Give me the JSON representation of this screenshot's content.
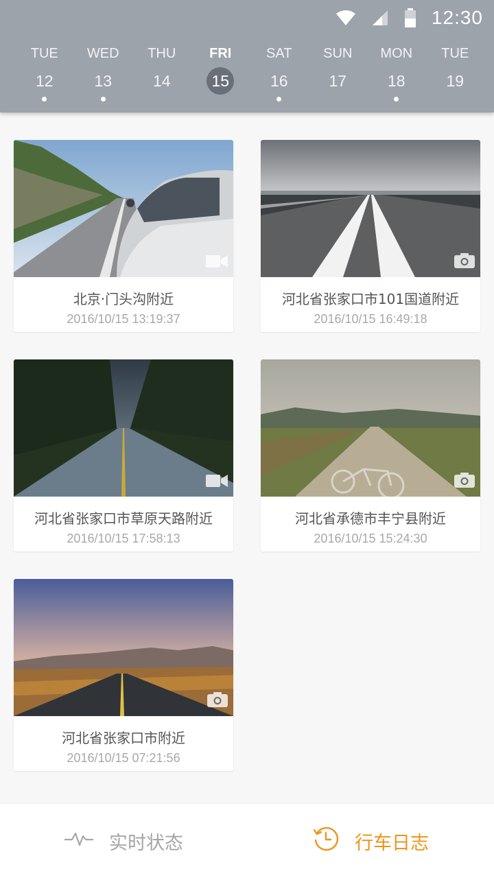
{
  "status_bar": {
    "time": "12:30",
    "icons": [
      "wifi-icon",
      "cell-signal-icon",
      "battery-icon"
    ]
  },
  "calendar": {
    "days": [
      {
        "dow": "TUE",
        "date": "12",
        "has_entries": true,
        "selected": false
      },
      {
        "dow": "WED",
        "date": "13",
        "has_entries": true,
        "selected": false
      },
      {
        "dow": "THU",
        "date": "14",
        "has_entries": false,
        "selected": false
      },
      {
        "dow": "FRI",
        "date": "15",
        "has_entries": false,
        "selected": true
      },
      {
        "dow": "SAT",
        "date": "16",
        "has_entries": true,
        "selected": false
      },
      {
        "dow": "SUN",
        "date": "17",
        "has_entries": false,
        "selected": false
      },
      {
        "dow": "MON",
        "date": "18",
        "has_entries": true,
        "selected": false
      },
      {
        "dow": "TUE",
        "date": "19",
        "has_entries": false,
        "selected": false
      }
    ]
  },
  "entries": [
    {
      "place": "北京·门头沟附近",
      "timestamp": "2016/10/15 13:19:37",
      "media": "video-icon",
      "scene": "car-on-mountain-road"
    },
    {
      "place": "河北省张家口市101国道附近",
      "timestamp": "2016/10/15 16:49:18",
      "media": "camera-icon",
      "scene": "highway-center-line"
    },
    {
      "place": "河北省张家口市草原天路附近",
      "timestamp": "2016/10/15 17:58:13",
      "media": "video-icon",
      "scene": "forest-road-dusk"
    },
    {
      "place": "河北省承德市丰宁县附近",
      "timestamp": "2016/10/15 15:24:30",
      "media": "camera-icon",
      "scene": "country-road-bicycle"
    },
    {
      "place": "河北省张家口市附近",
      "timestamp": "2016/10/15 07:21:56",
      "media": "camera-icon",
      "scene": "sunset-road-mountains"
    }
  ],
  "bottom_nav": {
    "items": [
      {
        "label": "实时状态",
        "icon": "pulse-icon",
        "active": false
      },
      {
        "label": "行车日志",
        "icon": "history-icon",
        "active": true
      }
    ]
  },
  "colors": {
    "header_bg": "#9da3ab",
    "selected_day_bg": "#6a7079",
    "accent": "#f09419",
    "inactive_nav": "#a6a6a6"
  }
}
